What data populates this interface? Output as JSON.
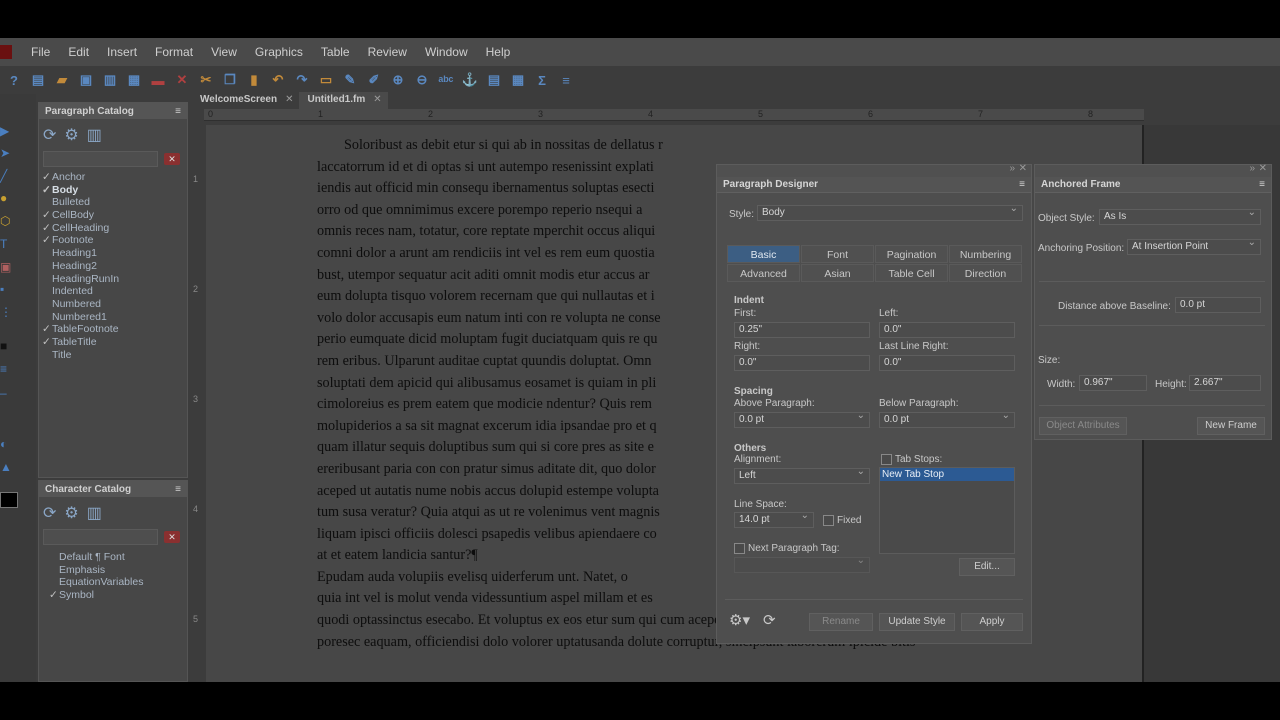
{
  "menubar": {
    "items": [
      "File",
      "Edit",
      "Insert",
      "Format",
      "View",
      "Graphics",
      "Table",
      "Review",
      "Window",
      "Help"
    ]
  },
  "toolbar": {
    "icons": [
      "help-icon",
      "new-icon",
      "open-icon",
      "save-icon",
      "save-all-icon",
      "print-icon",
      "lock-icon",
      "close-icon",
      "cut-icon",
      "copy-icon",
      "paste-icon",
      "undo-icon",
      "redo-icon",
      "insert-frame-icon",
      "spelling-icon",
      "track-changes-icon",
      "zoom-in-icon",
      "zoom-out-icon",
      "abc-icon",
      "anchor-icon",
      "text-frame-icon",
      "table-icon",
      "sigma-icon",
      "variables-icon"
    ]
  },
  "paragraph_catalog": {
    "title": "Paragraph Catalog",
    "items": [
      {
        "label": "Anchor",
        "checked": true,
        "bold": false
      },
      {
        "label": "Body",
        "checked": true,
        "bold": true
      },
      {
        "label": "Bulleted",
        "checked": false,
        "bold": false
      },
      {
        "label": "CellBody",
        "checked": true,
        "bold": false
      },
      {
        "label": "CellHeading",
        "checked": true,
        "bold": false
      },
      {
        "label": "Footnote",
        "checked": true,
        "bold": false
      },
      {
        "label": "Heading1",
        "checked": false,
        "bold": false
      },
      {
        "label": "Heading2",
        "checked": false,
        "bold": false
      },
      {
        "label": "HeadingRunIn",
        "checked": false,
        "bold": false
      },
      {
        "label": "Indented",
        "checked": false,
        "bold": false
      },
      {
        "label": "Numbered",
        "checked": false,
        "bold": false
      },
      {
        "label": "Numbered1",
        "checked": false,
        "bold": false
      },
      {
        "label": "TableFootnote",
        "checked": true,
        "bold": false
      },
      {
        "label": "TableTitle",
        "checked": true,
        "bold": false
      },
      {
        "label": "Title",
        "checked": false,
        "bold": false
      }
    ]
  },
  "character_catalog": {
    "title": "Character Catalog",
    "items": [
      {
        "label": "Default ¶ Font",
        "checked": false
      },
      {
        "label": "Emphasis",
        "checked": false
      },
      {
        "label": "EquationVariables",
        "checked": false
      },
      {
        "label": "Symbol",
        "checked": true
      }
    ]
  },
  "tabs": [
    {
      "label": "WelcomeScreen",
      "active": false
    },
    {
      "label": "Untitled1.fm",
      "active": true
    }
  ],
  "ruler": {
    "h_marks": [
      "0",
      "1",
      "2",
      "3",
      "4",
      "5",
      "6",
      "7",
      "8"
    ],
    "v_marks": [
      "1",
      "2",
      "3",
      "4",
      "5"
    ]
  },
  "document": {
    "lines": [
      "Soloribust as debit etur si qui ab in nossitas de dellatus r",
      "laccatorrum id et di optas si unt autempo resenissint explati",
      "iendis aut officid min consequ ibernamentus soluptas esecti",
      "orro od que omnimimus excere porempo reperio nsequi a",
      "omnis reces nam, totatur, core reptate mperchit occus aliqui",
      "comni dolor a arunt am rendiciis int vel es rem eum quostia",
      "bust, utempor sequatur acit aditi omnit modis etur accus ar",
      "eum dolupta tisquo volorem recernam que qui nullautas et i",
      "volo dolor accusapis eum natum inti con re volupta ne conse",
      "perio eumquate dicid moluptam fugit duciatquam quis re qu",
      "rem eribus. Ulparunt auditae cuptat quundis doluptat. Omn",
      "soluptati dem apicid qui alibusamus eosamet is quiam in pli",
      "cimoloreius es prem eatem que modicie ndentur? Quis rem",
      "molupiderios a sa sit magnat excerum idia ipsandae pro et q",
      "quam illatur sequis doluptibus sum qui si core pres as site e",
      "ereribusant paria con con pratur simus aditate dit, quo dolor",
      "aceped ut autatis nume nobis accus dolupid estempe volupta",
      "tum susa veratur? Quia atqui as ut re volenimus vent magnis",
      "liquam ipisci officiis dolesci psapedis velibus apiendaere co",
      "at et eatem landicia santur?¶",
      "    Epudam auda volupiis evelisq uiderferum unt. Natet, o",
      "quia int vel is molut venda videssuntium aspel millam et es",
      "quodi optassinctus esecabo. Et voluptus ex eos etur sum qui cum acepe lab inis ellis incipsa nditincto blaute",
      "poresec eaquam, officiendisi dolo volorer uptatusanda dolute corruptur, sincipsunt laborerum ipicide bitis-"
    ]
  },
  "paragraph_designer": {
    "title": "Paragraph Designer",
    "style_label": "Style:",
    "style_value": "Body",
    "tabs_row1": [
      "Basic",
      "Font",
      "Pagination",
      "Numbering"
    ],
    "tabs_row2": [
      "Advanced",
      "Asian",
      "Table Cell",
      "Direction"
    ],
    "indent": {
      "heading": "Indent",
      "first_label": "First:",
      "first_value": "0.25\"",
      "left_label": "Left:",
      "left_value": "0.0\"",
      "right_label": "Right:",
      "right_value": "0.0\"",
      "last_line_label": "Last Line Right:",
      "last_line_value": "0.0\""
    },
    "spacing": {
      "heading": "Spacing",
      "above_label": "Above Paragraph:",
      "above_value": "0.0 pt",
      "below_label": "Below Paragraph:",
      "below_value": "0.0 pt"
    },
    "others": {
      "heading": "Others",
      "alignment_label": "Alignment:",
      "alignment_value": "Left",
      "tab_stops_label": "Tab Stops:",
      "tab_stop_item": "New Tab Stop",
      "line_space_label": "Line Space:",
      "line_space_value": "14.0 pt",
      "fixed_label": "Fixed",
      "next_tag_label": "Next Paragraph Tag:",
      "edit_label": "Edit..."
    },
    "buttons": {
      "rename": "Rename",
      "update": "Update Style",
      "apply": "Apply"
    }
  },
  "anchored_frame": {
    "title": "Anchored Frame",
    "object_style_label": "Object Style:",
    "object_style_value": "As Is",
    "anchoring_label": "Anchoring Position:",
    "anchoring_value": "At Insertion Point",
    "distance_label": "Distance above Baseline:",
    "distance_value": "0.0 pt",
    "size_label": "Size:",
    "width_label": "Width:",
    "width_value": "0.967\"",
    "height_label": "Height:",
    "height_value": "2.667\"",
    "object_attributes": "Object Attributes",
    "new_frame": "New Frame"
  }
}
